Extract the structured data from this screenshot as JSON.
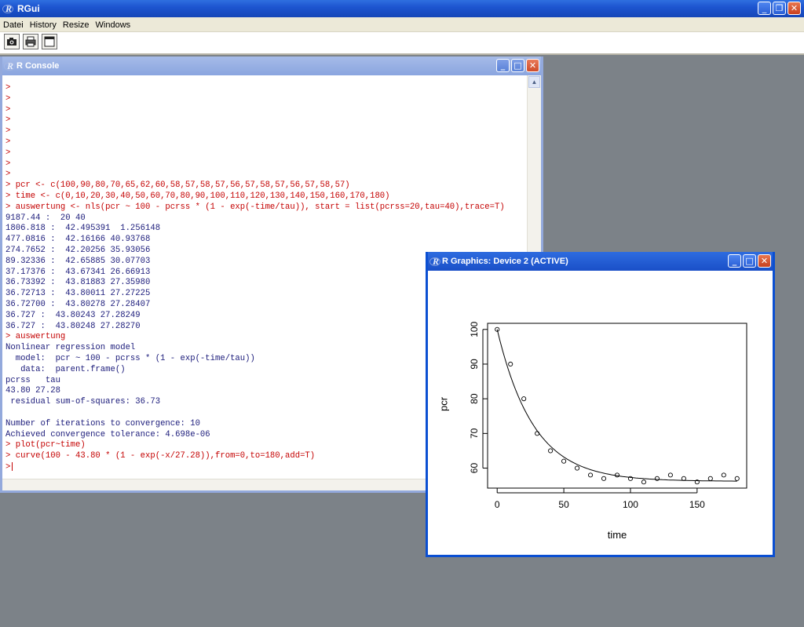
{
  "app": {
    "title": "RGui",
    "menu": [
      "Datei",
      "History",
      "Resize",
      "Windows"
    ],
    "toolbar_icons": [
      "camera-icon",
      "printer-icon",
      "window-icon"
    ]
  },
  "console": {
    "title": "R Console",
    "lines": [
      {
        "text": ">",
        "kind": "in"
      },
      {
        "text": ">",
        "kind": "in"
      },
      {
        "text": ">",
        "kind": "in"
      },
      {
        "text": ">",
        "kind": "in"
      },
      {
        "text": ">",
        "kind": "in"
      },
      {
        "text": ">",
        "kind": "in"
      },
      {
        "text": ">",
        "kind": "in"
      },
      {
        "text": ">",
        "kind": "in"
      },
      {
        "text": ">",
        "kind": "in"
      },
      {
        "text": "> pcr <- c(100,90,80,70,65,62,60,58,57,58,57,56,57,58,57,56,57,58,57)",
        "kind": "in"
      },
      {
        "text": "> time <- c(0,10,20,30,40,50,60,70,80,90,100,110,120,130,140,150,160,170,180)",
        "kind": "in"
      },
      {
        "text": "> auswertung <- nls(pcr ~ 100 - pcrss * (1 - exp(-time/tau)), start = list(pcrss=20,tau=40),trace=T)",
        "kind": "in"
      },
      {
        "text": "9187.44 :  20 40",
        "kind": "out"
      },
      {
        "text": "1806.818 :  42.495391  1.256148",
        "kind": "out"
      },
      {
        "text": "477.0816 :  42.16166 40.93768",
        "kind": "out"
      },
      {
        "text": "274.7652 :  42.20256 35.93056",
        "kind": "out"
      },
      {
        "text": "89.32336 :  42.65885 30.07703",
        "kind": "out"
      },
      {
        "text": "37.17376 :  43.67341 26.66913",
        "kind": "out"
      },
      {
        "text": "36.73392 :  43.81883 27.35980",
        "kind": "out"
      },
      {
        "text": "36.72713 :  43.80011 27.27225",
        "kind": "out"
      },
      {
        "text": "36.72700 :  43.80278 27.28407",
        "kind": "out"
      },
      {
        "text": "36.727 :  43.80243 27.28249",
        "kind": "out"
      },
      {
        "text": "36.727 :  43.80248 27.28270",
        "kind": "out"
      },
      {
        "text": "> auswertung",
        "kind": "in"
      },
      {
        "text": "Nonlinear regression model",
        "kind": "out"
      },
      {
        "text": "  model:  pcr ~ 100 - pcrss * (1 - exp(-time/tau))",
        "kind": "out"
      },
      {
        "text": "   data:  parent.frame()",
        "kind": "out"
      },
      {
        "text": "pcrss   tau",
        "kind": "out"
      },
      {
        "text": "43.80 27.28",
        "kind": "out"
      },
      {
        "text": " residual sum-of-squares: 36.73",
        "kind": "out"
      },
      {
        "text": "",
        "kind": "out"
      },
      {
        "text": "Number of iterations to convergence: 10",
        "kind": "out"
      },
      {
        "text": "Achieved convergence tolerance: 4.698e-06",
        "kind": "out"
      },
      {
        "text": "> plot(pcr~time)",
        "kind": "in"
      },
      {
        "text": "> curve(100 - 43.80 * (1 - exp(-x/27.28)),from=0,to=180,add=T)",
        "kind": "in"
      },
      {
        "text": ">",
        "kind": "in",
        "cursor": true
      }
    ]
  },
  "graphics": {
    "title": "R Graphics: Device 2 (ACTIVE)"
  },
  "chart_data": {
    "type": "scatter",
    "title": "",
    "xlabel": "time",
    "ylabel": "pcr",
    "xlim": [
      0,
      180
    ],
    "ylim": [
      56,
      100
    ],
    "x_ticks": [
      0,
      50,
      100,
      150
    ],
    "y_ticks": [
      60,
      70,
      80,
      90,
      100
    ],
    "grid": false,
    "series": [
      {
        "type": "scatter",
        "x": [
          0,
          10,
          20,
          30,
          40,
          50,
          60,
          70,
          80,
          90,
          100,
          110,
          120,
          130,
          140,
          150,
          160,
          170,
          180
        ],
        "y": [
          100,
          90,
          80,
          70,
          65,
          62,
          60,
          58,
          57,
          58,
          57,
          56,
          57,
          58,
          57,
          56,
          57,
          58,
          57
        ]
      },
      {
        "type": "line",
        "function": "100 - 43.80 * (1 - exp(-x/27.28))",
        "from": 0,
        "to": 180
      }
    ]
  },
  "colors": {
    "input_text": "#c40000",
    "output_text": "#1a1a7a",
    "desktop": "#7c8288"
  }
}
